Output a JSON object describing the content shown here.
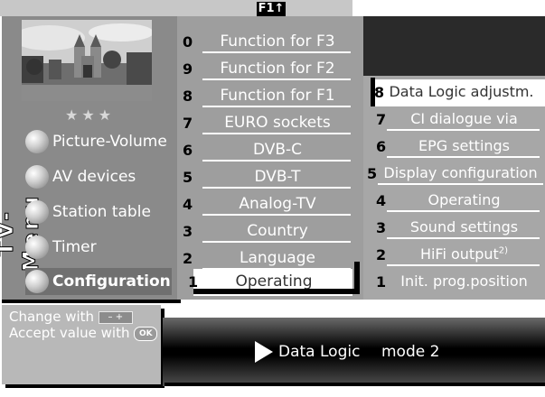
{
  "header": {
    "key_label": "F1",
    "arrow": "↑"
  },
  "left_menu": {
    "vertical_title": "TV-Menu",
    "stars": "★★★",
    "items": [
      {
        "label": "Picture-Volume"
      },
      {
        "label": "AV devices"
      },
      {
        "label": "Station table"
      },
      {
        "label": "Timer"
      },
      {
        "label": "Configuration",
        "selected": true
      }
    ]
  },
  "help": {
    "change_with": "Change with",
    "minus_plus": "– +",
    "accept_with": "Accept value with",
    "ok": "OK"
  },
  "middle_list": {
    "items": [
      {
        "num": "0",
        "label": "Function for F3"
      },
      {
        "num": "9",
        "label": "Function for F2"
      },
      {
        "num": "8",
        "label": "Function for F1"
      },
      {
        "num": "7",
        "label": "EURO sockets"
      },
      {
        "num": "6",
        "label": "DVB-C"
      },
      {
        "num": "5",
        "label": "DVB-T"
      },
      {
        "num": "4",
        "label": "Analog-TV"
      },
      {
        "num": "3",
        "label": "Country"
      },
      {
        "num": "2",
        "label": "Language"
      },
      {
        "num": "1",
        "label": "Operating",
        "selected": true
      }
    ]
  },
  "right_list": {
    "items": [
      {
        "num": "8",
        "label": "Data Logic adjustm.",
        "selected": true
      },
      {
        "num": "7",
        "label": "CI dialogue via"
      },
      {
        "num": "6",
        "label": "EPG settings"
      },
      {
        "num": "5",
        "label": "Display configuration"
      },
      {
        "num": "4",
        "label": "Operating"
      },
      {
        "num": "3",
        "label": "Sound settings"
      },
      {
        "num": "2",
        "label": "HiFi output",
        "sup": "2)"
      },
      {
        "num": "1",
        "label": "Init. prog.position"
      }
    ]
  },
  "status_bar": {
    "label": "Data Logic",
    "value": "mode 2"
  },
  "colors": {
    "panel_gray": "#8a8a8a",
    "mid_gray": "#9e9e9e",
    "right_gray": "#a7a7a7",
    "selected_bg": "#ffffff",
    "dark": "#000000"
  }
}
